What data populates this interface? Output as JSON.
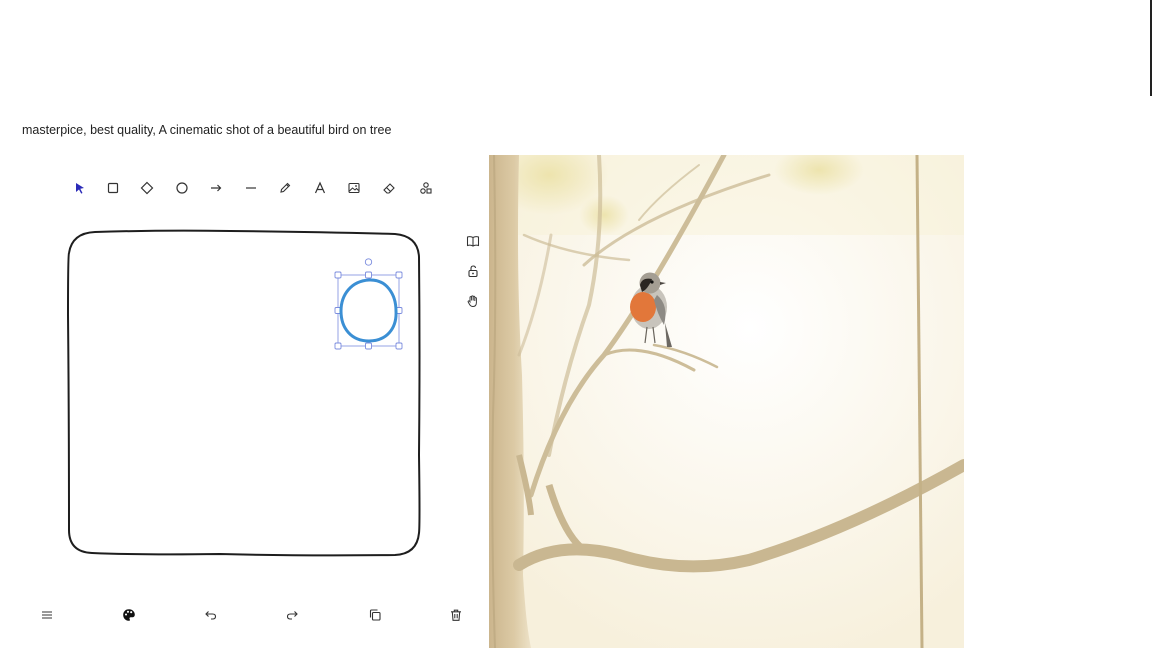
{
  "prompt": {
    "text": "masterpice, best quality, A cinematic shot of a beautiful bird on tree"
  },
  "toolbar": {
    "tools": [
      {
        "name": "select-tool",
        "icon": "cursor-arrow-icon",
        "active": true
      },
      {
        "name": "rectangle-tool",
        "icon": "square-icon"
      },
      {
        "name": "diamond-tool",
        "icon": "diamond-icon"
      },
      {
        "name": "ellipse-tool",
        "icon": "circle-icon"
      },
      {
        "name": "arrow-tool",
        "icon": "arrow-right-icon"
      },
      {
        "name": "line-tool",
        "icon": "line-icon"
      },
      {
        "name": "pencil-tool",
        "icon": "pencil-icon"
      },
      {
        "name": "text-tool",
        "icon": "text-a-icon"
      },
      {
        "name": "image-tool",
        "icon": "image-icon"
      },
      {
        "name": "eraser-tool",
        "icon": "eraser-icon"
      },
      {
        "name": "shapes-library-tool",
        "icon": "shapes-icon"
      }
    ]
  },
  "side_tools": [
    {
      "name": "library-button",
      "icon": "book-icon"
    },
    {
      "name": "lock-button",
      "icon": "unlock-icon"
    },
    {
      "name": "hand-button",
      "icon": "hand-icon"
    }
  ],
  "bottom_bar": [
    {
      "name": "menu-button",
      "icon": "hamburger-icon"
    },
    {
      "name": "color-palette-button",
      "icon": "palette-icon"
    },
    {
      "name": "undo-button",
      "icon": "undo-icon"
    },
    {
      "name": "redo-button",
      "icon": "redo-icon"
    },
    {
      "name": "duplicate-button",
      "icon": "copy-icon"
    },
    {
      "name": "delete-button",
      "icon": "trash-icon"
    }
  ],
  "colors": {
    "accent": "#3a3af0",
    "selection": "#7b8cde",
    "stroke": "#1e1e1e",
    "ellipse": "#3b8fd4",
    "image_bg": "#fbf6ea",
    "branch": "#cfc1a0",
    "bird_breast": "#e2773a"
  }
}
